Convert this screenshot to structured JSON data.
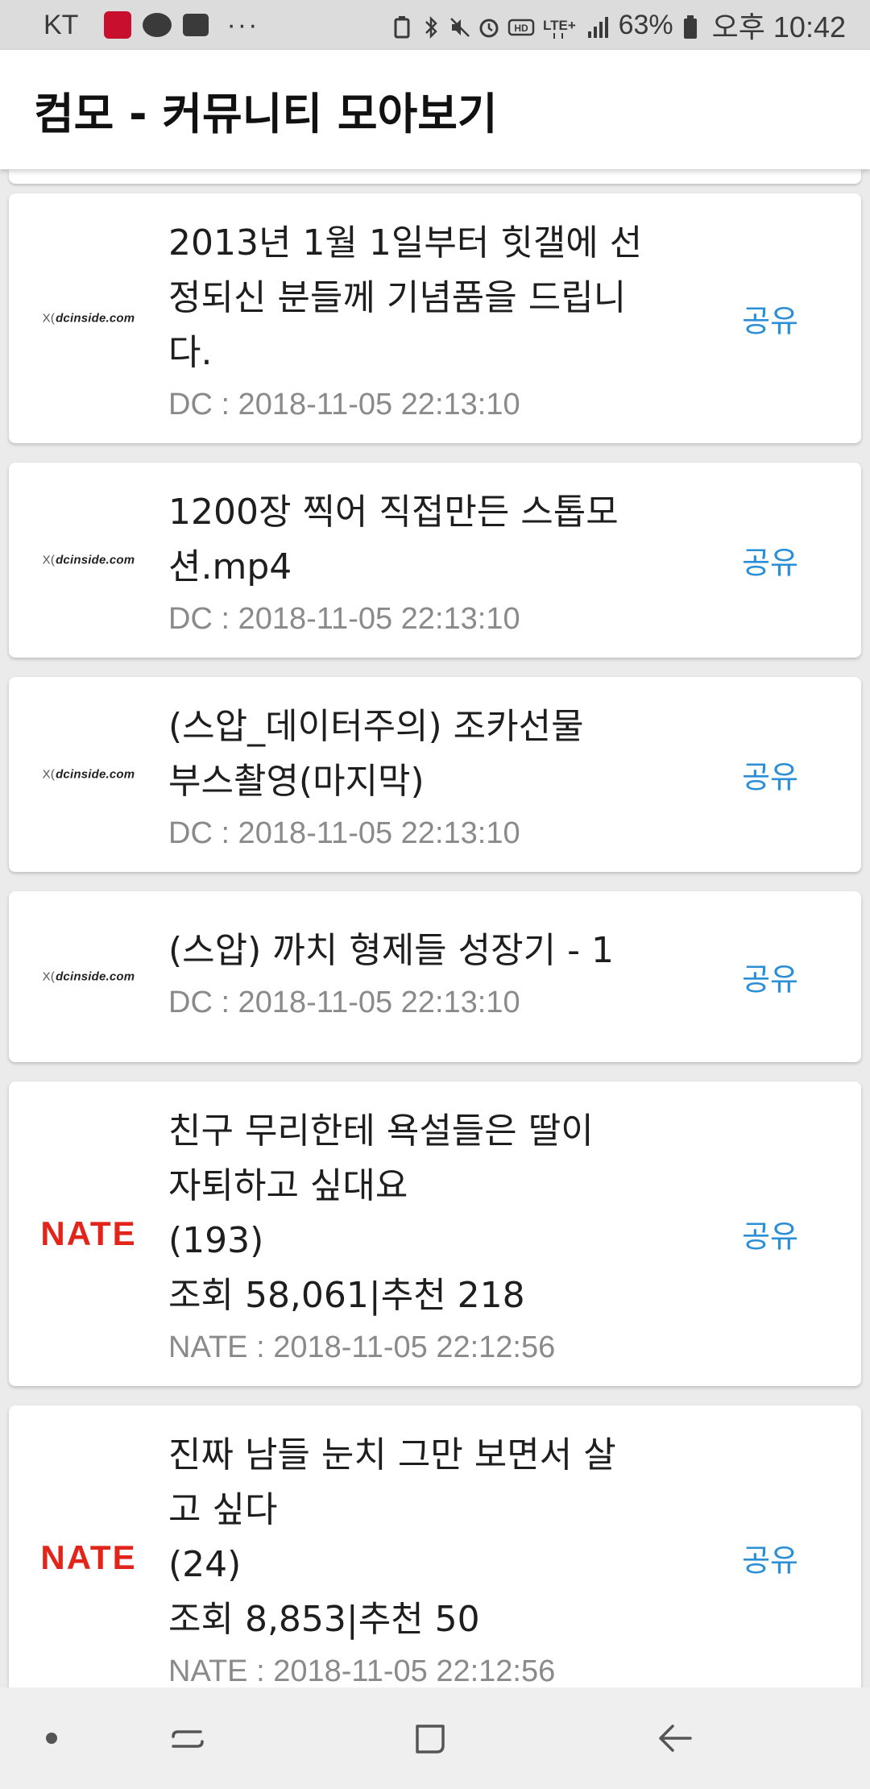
{
  "status_bar": {
    "carrier": "KT",
    "more": "···",
    "battery_percent": "63%",
    "clock": "오후 10:42",
    "icons": [
      "app-notification-icon",
      "talk-icon",
      "message-icon",
      "battery-saver-icon",
      "bluetooth-icon",
      "mute-icon",
      "alarm-icon",
      "hd-icon",
      "lte-icon",
      "signal-icon",
      "battery-icon"
    ]
  },
  "app_bar": {
    "title": "컴모 - 커뮤니티 모아보기"
  },
  "posts": [
    {
      "source": "dc",
      "logo_text": "dcinside.com",
      "logo_prefix": "X(",
      "title_lines": [
        "2013년 1월 1일부터 힛갤에 선",
        "정되신 분들께 기념품을 드립니",
        "다."
      ],
      "meta": "DC : 2018-11-05 22:13:10",
      "share": "공유"
    },
    {
      "source": "dc",
      "logo_text": "dcinside.com",
      "logo_prefix": "X(",
      "title_lines": [
        "1200장 찍어 직접만든 스톱모",
        "션.mp4"
      ],
      "meta": "DC : 2018-11-05 22:13:10",
      "share": "공유"
    },
    {
      "source": "dc",
      "logo_text": "dcinside.com",
      "logo_prefix": "X(",
      "title_lines": [
        "(스압_데이터주의) 조카선물",
        "부스촬영(마지막)"
      ],
      "meta": "DC : 2018-11-05 22:13:10",
      "share": "공유"
    },
    {
      "source": "dc",
      "logo_text": "dcinside.com",
      "logo_prefix": "X(",
      "title_lines": [
        "(스압) 까치 형제들 성장기 - 1"
      ],
      "meta": "DC : 2018-11-05 22:13:10",
      "share": "공유"
    },
    {
      "source": "nate",
      "logo_text": "NATE",
      "title_lines": [
        "친구 무리한테 욕설들은 딸이",
        "자퇴하고 싶대요"
      ],
      "comments": "(193)",
      "stats": "조회 58,061|추천 218",
      "meta": "NATE : 2018-11-05 22:12:56",
      "share": "공유"
    },
    {
      "source": "nate",
      "logo_text": "NATE",
      "title_lines": [
        "진짜 남들 눈치 그만 보면서 살",
        "고 싶다"
      ],
      "comments": "(24)",
      "stats": "조회 8,853|추천 50",
      "meta": "NATE : 2018-11-05 22:12:56",
      "share": "공유"
    }
  ],
  "nav_bar": {
    "items": [
      "nav-dot-icon",
      "recent-apps-icon",
      "home-icon",
      "back-icon"
    ]
  },
  "colors": {
    "accent": "#2a8fd6",
    "nate_brand": "#e1251b",
    "meta_text": "#8a8a8a",
    "background": "#ebebeb"
  }
}
